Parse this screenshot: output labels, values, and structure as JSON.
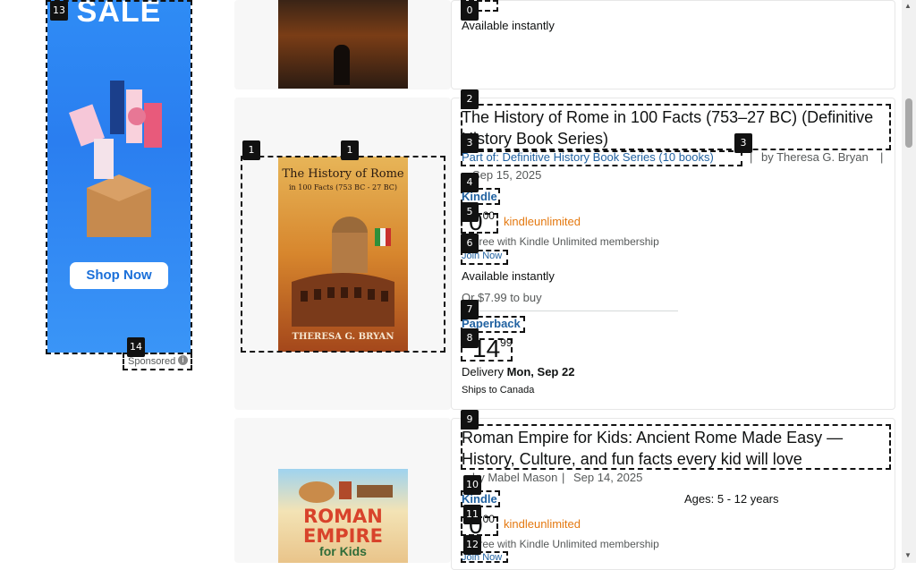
{
  "ad": {
    "headline": "SALE",
    "cta": "Shop Now",
    "sponsored": "Sponsored",
    "bg_color": "#2f8cf5"
  },
  "products": [
    {
      "availability": "Available instantly"
    },
    {
      "title": "The History of Rome in 100 Facts (753–27 BC) (Definitive History Book Series)",
      "cover_title": "The History of Rome",
      "cover_subtitle": "in 100 Facts (753 BC - 27 BC)",
      "cover_author": "THERESA G. BRYAN",
      "series": "Part of: Definitive History Book Series (10 books)",
      "author": "by Theresa G. Bryan",
      "date": "Sep 15, 2025",
      "format1": "Kindle",
      "price1_whole": "0",
      "price1_frac": "00",
      "ku_logo": "kindleunlimited",
      "ku_note": "Free with Kindle Unlimited membership",
      "join": "Join Now",
      "availability": "Available instantly",
      "buy_alt": "Or $7.99 to buy",
      "format2": "Paperback",
      "price2_whole": "14",
      "price2_frac": "99",
      "delivery_label": "Delivery",
      "delivery_date": "Mon, Sep 22",
      "ships": "Ships to Canada"
    },
    {
      "title": "Roman Empire for Kids: Ancient Rome Made Easy — History, Culture, and fun facts every kid will love",
      "cover_title": "ROMAN EMPIRE",
      "cover_subtitle": "for Kids",
      "author": "by Mabel Mason",
      "date": "Sep 14, 2025",
      "ages": "Ages: 5 - 12 years",
      "format1": "Kindle",
      "price1_whole": "0",
      "price1_frac": "00",
      "ku_logo": "kindleunlimited",
      "ku_note": "Free with Kindle Unlimited membership",
      "join": "Join Now"
    }
  ],
  "tags": [
    "0",
    "1",
    "1",
    "2",
    "3",
    "3",
    "4",
    "5",
    "6",
    "7",
    "8",
    "9",
    "10",
    "11",
    "12",
    "13",
    "14"
  ]
}
